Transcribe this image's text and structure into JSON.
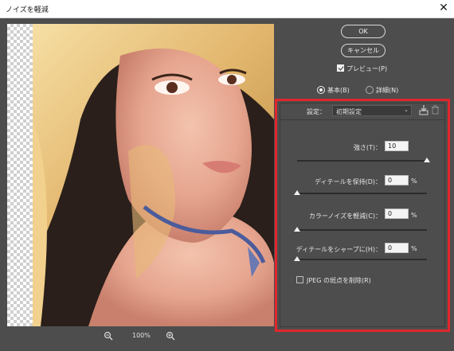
{
  "window": {
    "title": "ノイズを軽減",
    "close_glyph": "✕"
  },
  "buttons": {
    "ok": "OK",
    "cancel": "キャンセル"
  },
  "preview_checkbox": {
    "label": "プレビュー(P)",
    "checked": true
  },
  "mode": {
    "basic": "基本(B)",
    "advanced": "詳細(N)",
    "selected": "basic"
  },
  "settings": {
    "label": "設定：",
    "preset": "初期設定",
    "sliders": [
      {
        "name": "strength",
        "label": "強さ(T)：",
        "value": "10",
        "unit": "",
        "max": 10
      },
      {
        "name": "preserve-details",
        "label": "ディテールを保持(D)：",
        "value": "0",
        "unit": "%",
        "max": 100
      },
      {
        "name": "reduce-color-noise",
        "label": "カラーノイズを軽減(C)：",
        "value": "0",
        "unit": "%",
        "max": 100
      },
      {
        "name": "sharpen-details",
        "label": "ディテールをシャープに(H)：",
        "value": "0",
        "unit": "%",
        "max": 100
      }
    ],
    "jpeg_checkbox": {
      "label": "JPEG の斑点を削除(R)",
      "checked": false
    }
  },
  "zoom": {
    "level": "100%"
  },
  "colors": {
    "panel": "#4d4d4d",
    "highlight_frame": "#e0262d"
  }
}
